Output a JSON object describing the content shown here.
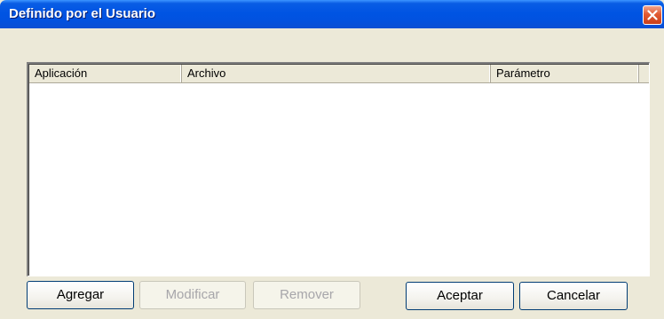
{
  "window": {
    "title": "Definido por el Usuario"
  },
  "list": {
    "columns": [
      "Aplicación",
      "Archivo",
      "Parámetro"
    ],
    "rows": []
  },
  "buttons": {
    "add": "Agregar",
    "edit": "Modificar",
    "remove": "Remover",
    "ok": "Aceptar",
    "cancel": "Cancelar"
  },
  "icons": {
    "close": "close-icon"
  },
  "colors": {
    "titlebar": "#0054e3",
    "close_button": "#e15a32",
    "dialog_background": "#ece9d8",
    "disabled_text": "#a7a6aa"
  }
}
